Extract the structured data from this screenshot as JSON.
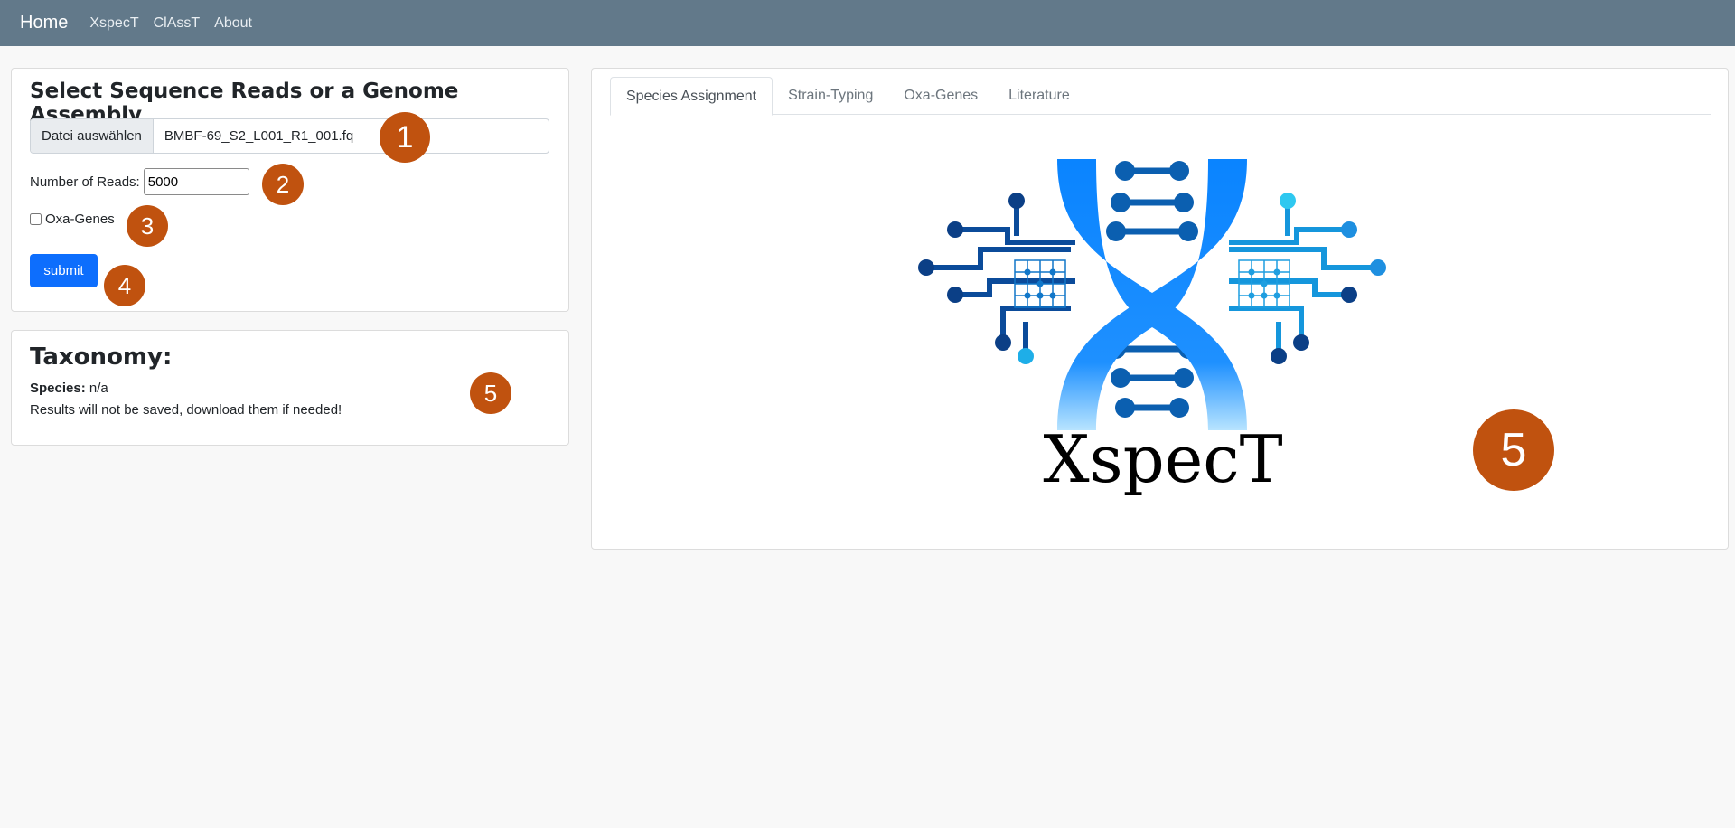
{
  "nav": {
    "brand": "Home",
    "links": [
      "XspecT",
      "ClAssT",
      "About"
    ]
  },
  "upload": {
    "title": "Select Sequence Reads or a Genome Assembly",
    "file_button": "Datei auswählen",
    "file_name": "BMBF-69_S2_L001_R1_001.fq",
    "reads_label": "Number of Reads:",
    "reads_value": "5000",
    "checkbox_label": "Oxa-Genes",
    "checkbox_checked": false,
    "submit_label": "submit"
  },
  "taxonomy": {
    "title": "Taxonomy:",
    "species_label": "Species:",
    "species_value": " n/a",
    "note": "Results will not be saved, download them if needed!"
  },
  "results": {
    "tabs": [
      "Species Assignment",
      "Strain-Typing",
      "Oxa-Genes",
      "Literature"
    ],
    "active_tab": "Species Assignment",
    "logo_text": "XspecT"
  },
  "annotations": [
    "1",
    "2",
    "3",
    "4",
    "5",
    "5"
  ],
  "colors": {
    "navbar": "#62798a",
    "badge": "#c0520f",
    "primary": "#0d6efd",
    "logo_dark": "#0a3d7a",
    "logo_mid": "#1e7fd0",
    "logo_light": "#2ec8f0"
  },
  "icons": [
    "dna-helix-icon",
    "circuit-icon"
  ]
}
